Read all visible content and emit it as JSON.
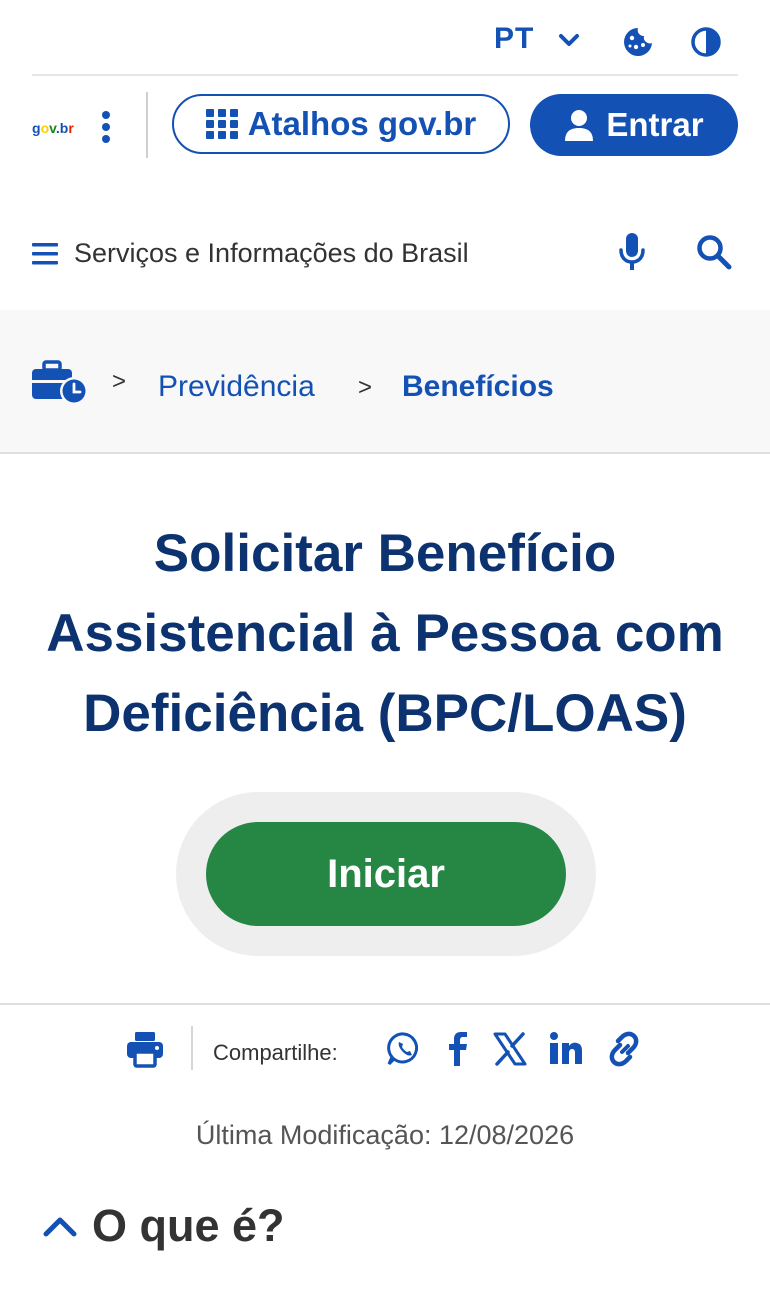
{
  "utility_bar": {
    "language": "PT",
    "icons": [
      "chevron-down-icon",
      "cookie-icon",
      "contrast-icon"
    ]
  },
  "header": {
    "logo_text": "gov.br",
    "atalhos_label": "Atalhos gov.br",
    "entrar_label": "Entrar"
  },
  "nav": {
    "title": "Serviços e Informações do Brasil"
  },
  "breadcrumb": {
    "separator": ">",
    "items": [
      "Previdência",
      "Benefícios"
    ]
  },
  "main": {
    "title_lines": [
      "Solicitar Benefício",
      "Assistencial à Pessoa com",
      "Deficiência (BPC/LOAS)"
    ],
    "start_label": "Iniciar"
  },
  "share": {
    "label": "Compartilhe:",
    "icons": [
      "whatsapp-icon",
      "facebook-icon",
      "x-icon",
      "linkedin-icon",
      "link-icon"
    ]
  },
  "last_modified": "Última Modificação: 12/08/2026",
  "section": {
    "title": "O que é?"
  },
  "colors": {
    "brand_blue": "#1351b4",
    "title_navy": "#0c326f",
    "start_green": "#268744"
  }
}
